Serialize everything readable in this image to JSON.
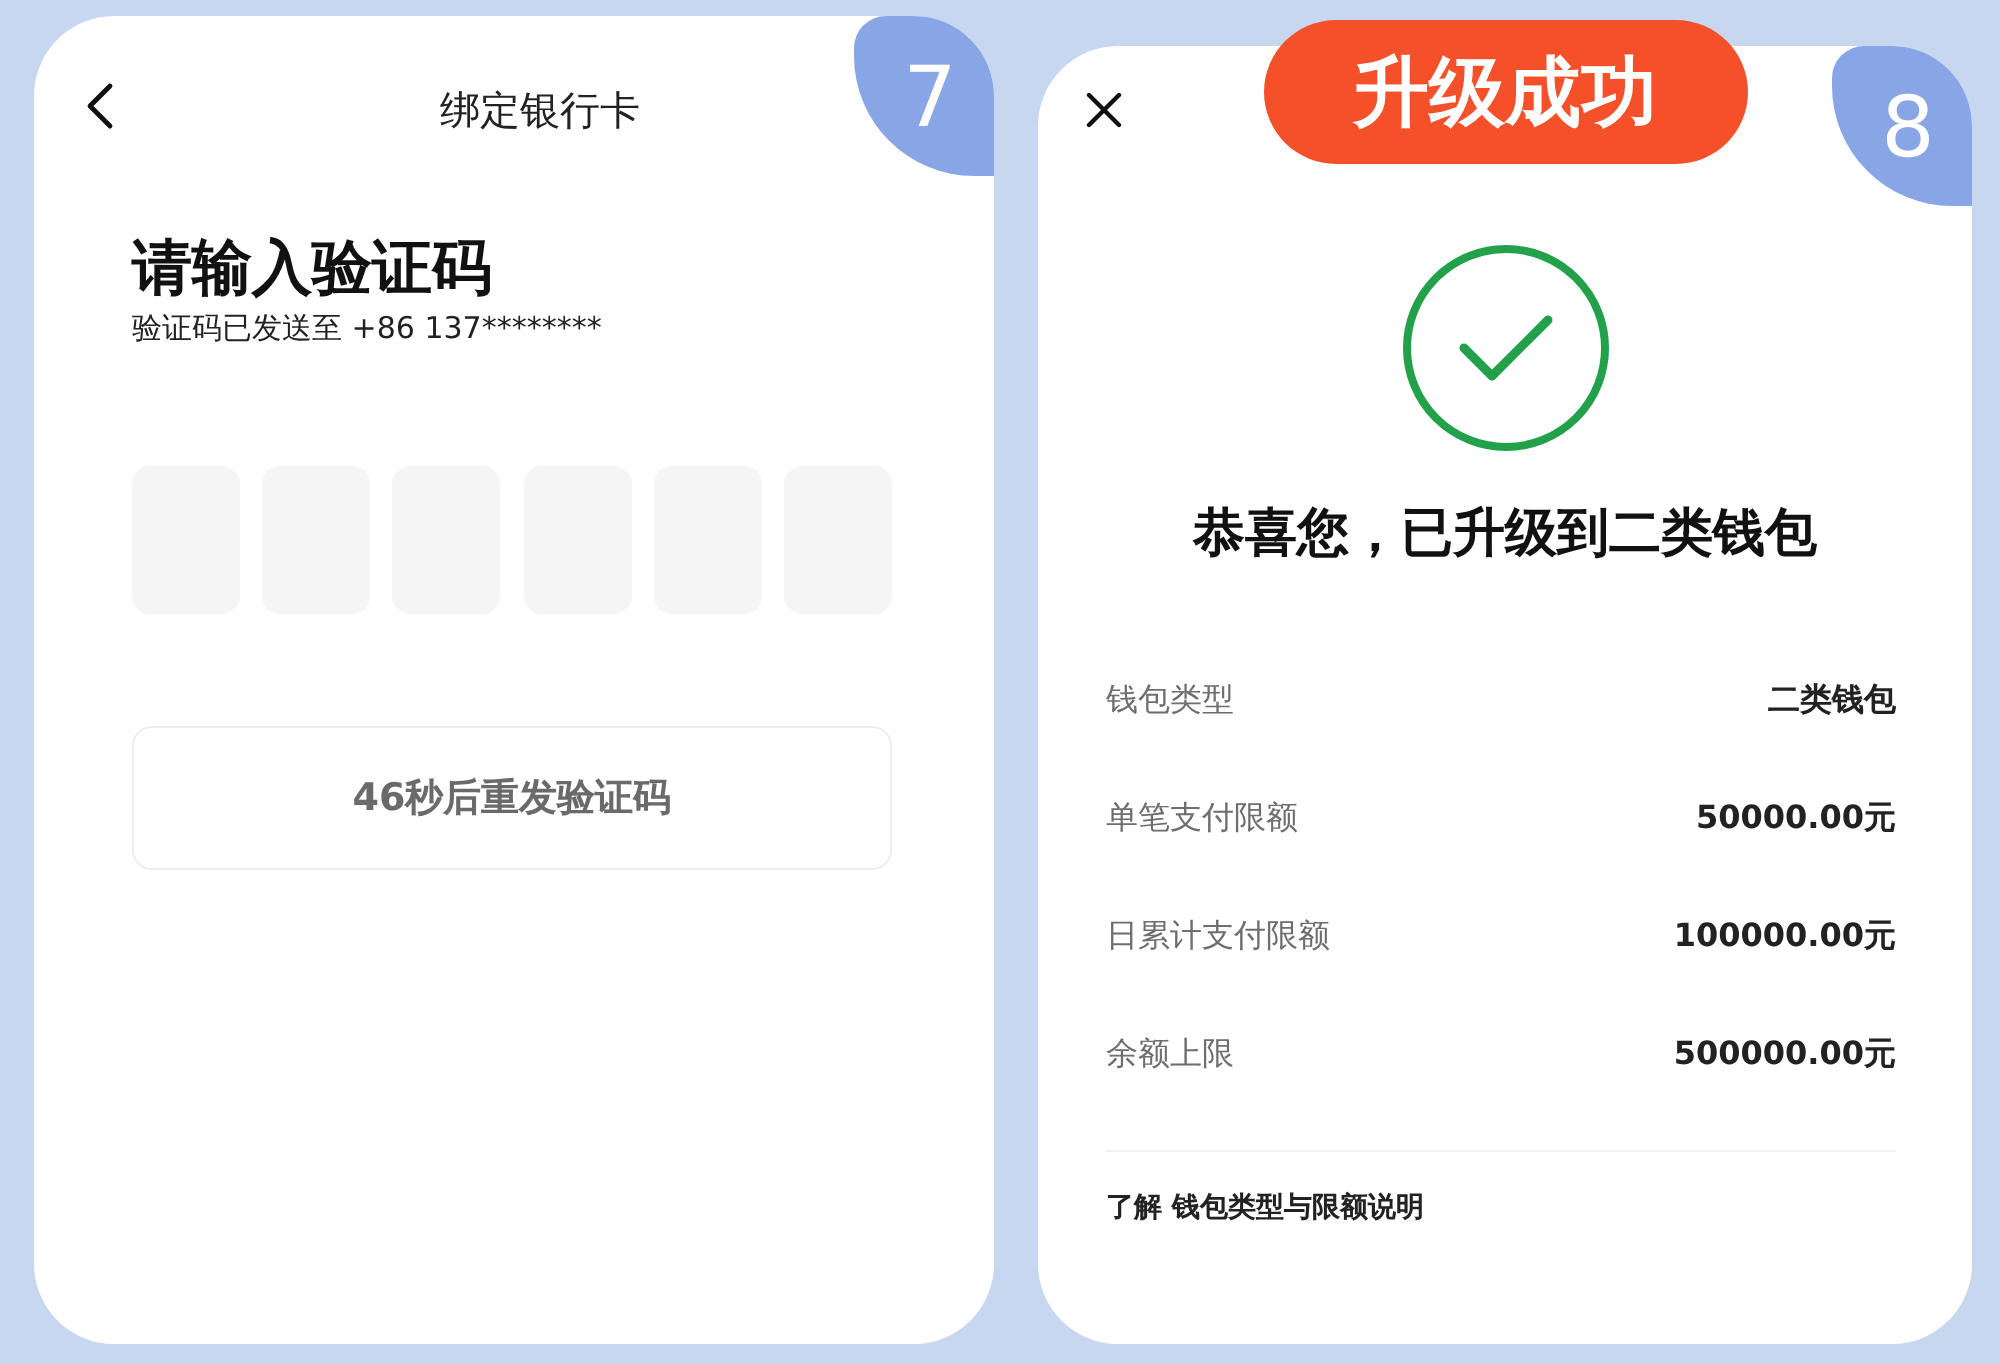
{
  "screens": [
    {
      "kind": "verify_code",
      "step": "7",
      "nav": {
        "kind": "back",
        "title": "绑定银行卡"
      },
      "heading": "请输入验证码",
      "subtitle": "验证码已发送至 +86 137********",
      "code_fields": [
        {
          "filled": false
        },
        {
          "filled": false
        },
        {
          "filled": false
        },
        {
          "filled": false
        },
        {
          "filled": false
        },
        {
          "filled": false
        }
      ],
      "resend_button": {
        "label": "46秒后重发验证码",
        "disabled": true
      }
    },
    {
      "kind": "upgrade_result",
      "step": "8",
      "banner": "升级成功",
      "nav": {
        "kind": "close"
      },
      "result": {
        "kind": "success",
        "title": "恭喜您，已升级到二类钱包"
      },
      "details": [
        {
          "label": "钱包类型",
          "value": "二类钱包"
        },
        {
          "label": "单笔支付限额",
          "value": "50000.00元"
        },
        {
          "label": "日累计支付限额",
          "value": "100000.00元"
        },
        {
          "label": "余额上限",
          "value": "500000.00元"
        }
      ],
      "link": "了解 钱包类型与限额说明"
    }
  ]
}
